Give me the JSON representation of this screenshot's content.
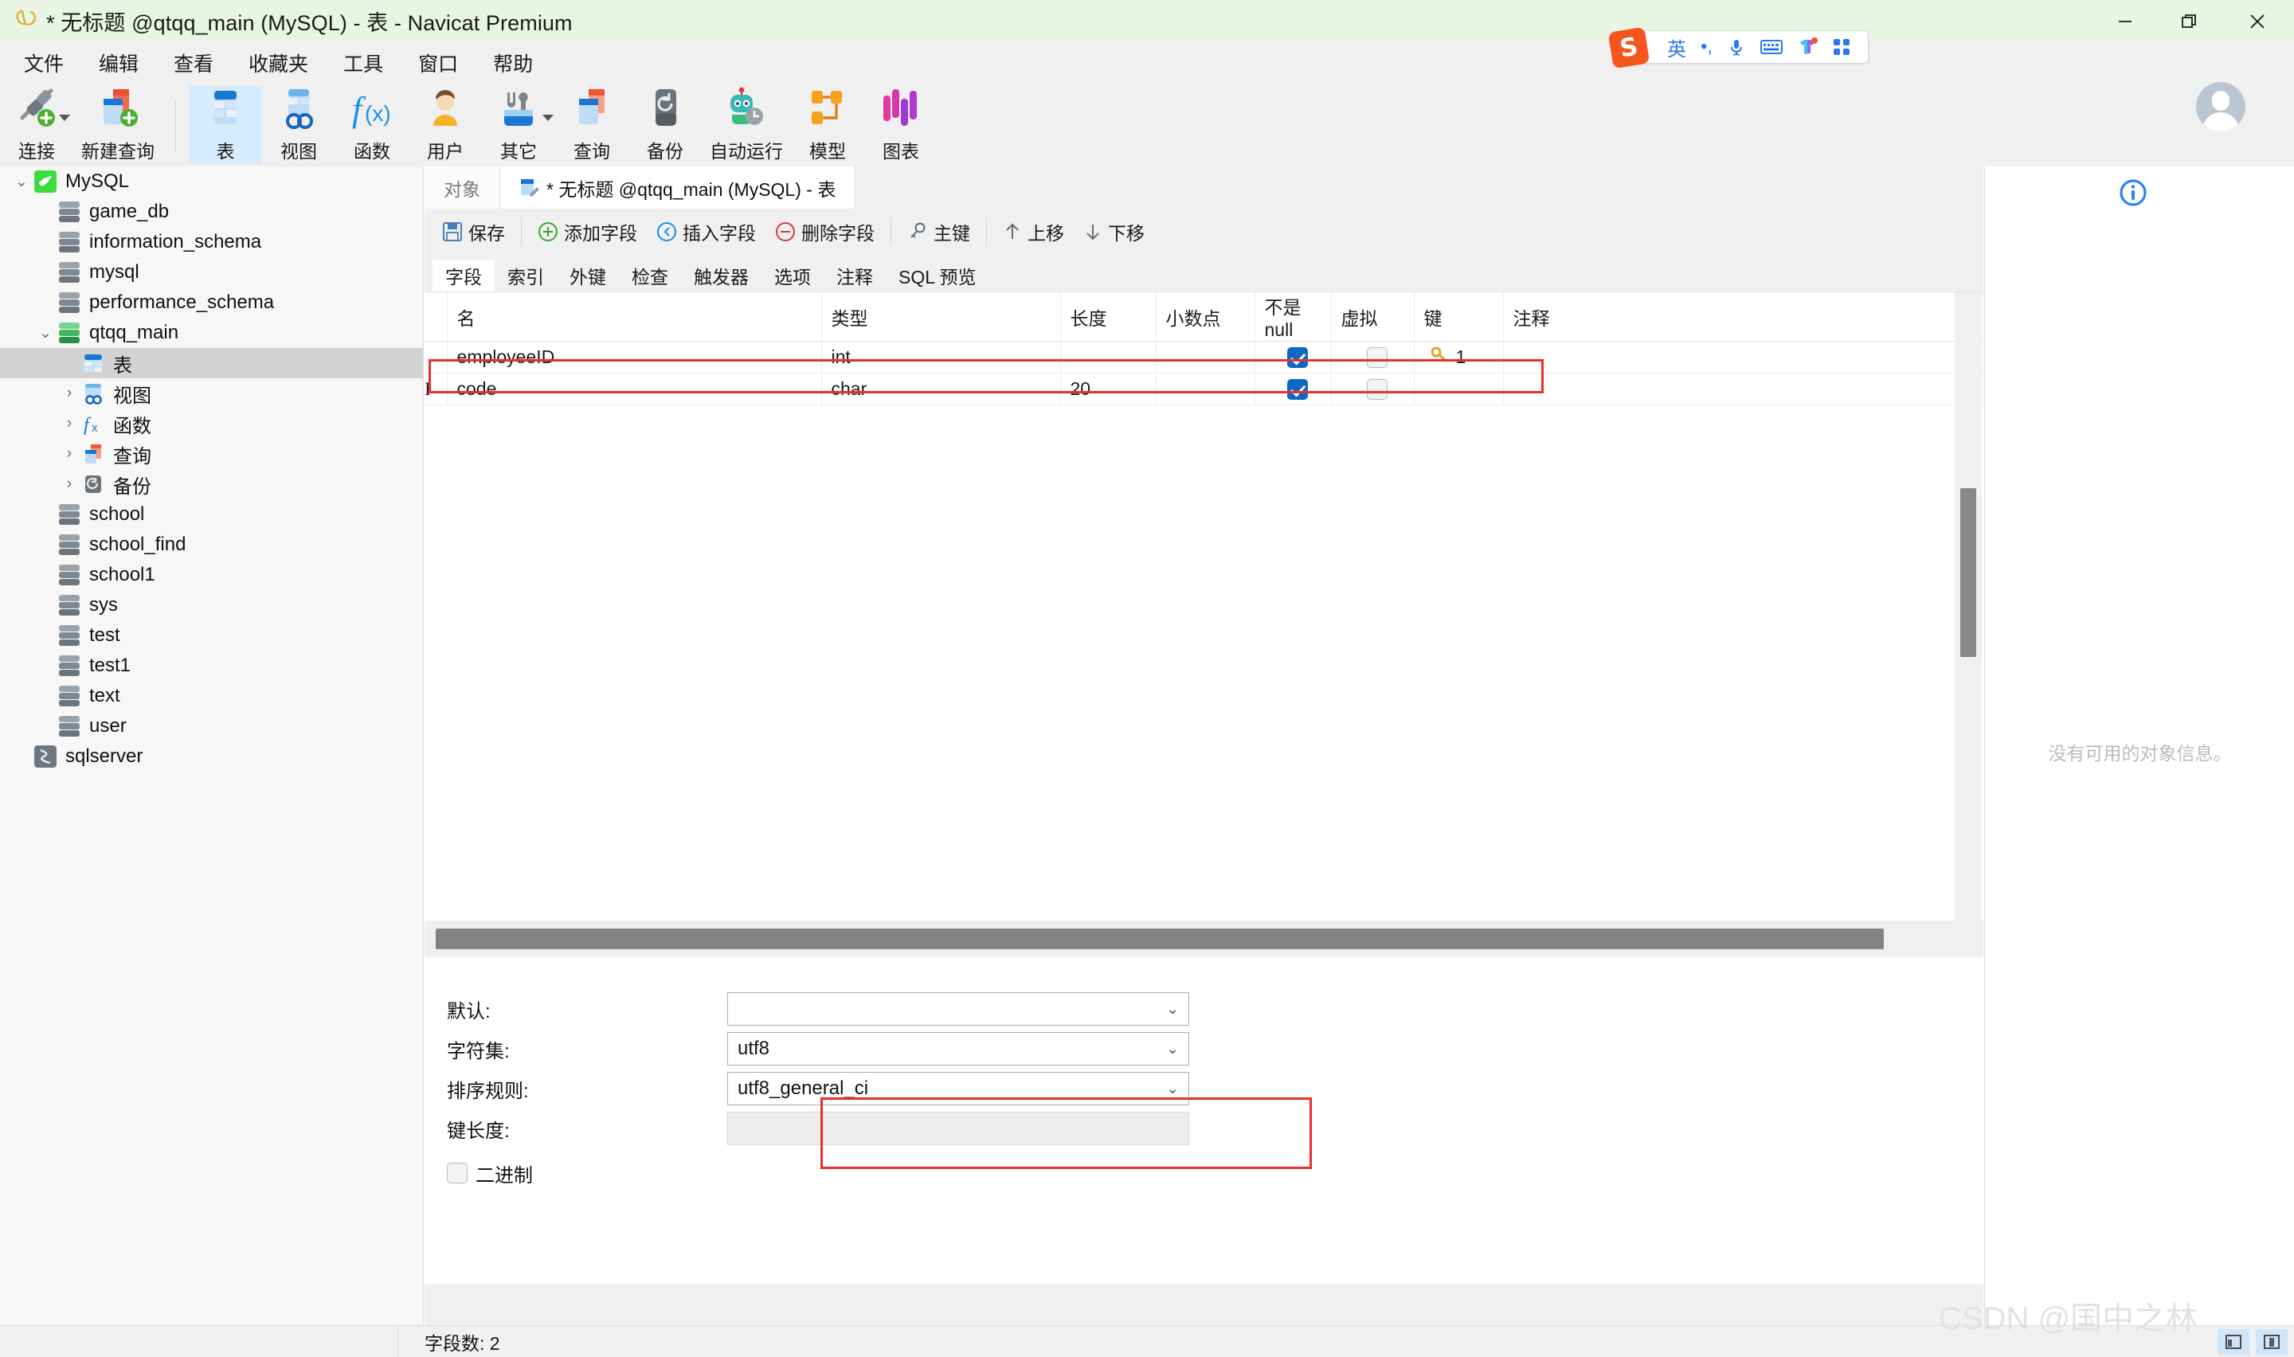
{
  "window": {
    "title": "* 无标题 @qtqq_main (MySQL) - 表 - Navicat Premium",
    "minimize_label": "—",
    "restore_label": "❐",
    "close_label": "✕",
    "titlebar_color": "#e8f5e3"
  },
  "menubar": {
    "items": [
      {
        "label": "文件"
      },
      {
        "label": "编辑"
      },
      {
        "label": "查看"
      },
      {
        "label": "收藏夹"
      },
      {
        "label": "工具"
      },
      {
        "label": "窗口"
      },
      {
        "label": "帮助"
      }
    ]
  },
  "ime": {
    "logo_text": "S",
    "mode_label": "英",
    "punct_label": "•,",
    "mic_label": "mic-icon",
    "keyboard_label": "keyboard-icon",
    "skin_label": "skin-icon",
    "apps_label": "apps-icon"
  },
  "toolbar": {
    "items": [
      {
        "label": "连接",
        "icon": "connection-icon",
        "dropdown": true,
        "active": false
      },
      {
        "label": "新建查询",
        "icon": "new-query-icon",
        "dropdown": false,
        "active": false
      },
      {
        "label": "表",
        "icon": "table-icon",
        "dropdown": false,
        "active": true
      },
      {
        "label": "视图",
        "icon": "view-icon",
        "dropdown": false,
        "active": false
      },
      {
        "label": "函数",
        "icon": "function-icon",
        "dropdown": false,
        "active": false
      },
      {
        "label": "用户",
        "icon": "user-icon",
        "dropdown": false,
        "active": false
      },
      {
        "label": "其它",
        "icon": "others-icon",
        "dropdown": true,
        "active": false
      },
      {
        "label": "查询",
        "icon": "query-icon",
        "dropdown": false,
        "active": false
      },
      {
        "label": "备份",
        "icon": "backup-icon",
        "dropdown": false,
        "active": false
      },
      {
        "label": "自动运行",
        "icon": "automation-icon",
        "dropdown": false,
        "active": false
      },
      {
        "label": "模型",
        "icon": "model-icon",
        "dropdown": false,
        "active": false
      },
      {
        "label": "图表",
        "icon": "chart-icon",
        "dropdown": false,
        "active": false
      }
    ]
  },
  "sidebar": {
    "items": [
      {
        "label": "MySQL",
        "indent": 0,
        "twisty": "down",
        "icon": "mysql-dolphin-icon",
        "selected": false
      },
      {
        "label": "game_db",
        "indent": 1,
        "twisty": "",
        "icon": "database-icon",
        "selected": false
      },
      {
        "label": "information_schema",
        "indent": 1,
        "twisty": "",
        "icon": "database-icon",
        "selected": false
      },
      {
        "label": "mysql",
        "indent": 1,
        "twisty": "",
        "icon": "database-icon",
        "selected": false
      },
      {
        "label": "performance_schema",
        "indent": 1,
        "twisty": "",
        "icon": "database-icon",
        "selected": false
      },
      {
        "label": "qtqq_main",
        "indent": 1,
        "twisty": "down",
        "icon": "database-open-icon",
        "selected": false
      },
      {
        "label": "表",
        "indent": 2,
        "twisty": "",
        "icon": "table-icon",
        "selected": true
      },
      {
        "label": "视图",
        "indent": 2,
        "twisty": "right",
        "icon": "view-icon",
        "selected": false
      },
      {
        "label": "函数",
        "indent": 2,
        "twisty": "right",
        "icon": "function-icon",
        "selected": false
      },
      {
        "label": "查询",
        "indent": 2,
        "twisty": "right",
        "icon": "query-icon",
        "selected": false
      },
      {
        "label": "备份",
        "indent": 2,
        "twisty": "right",
        "icon": "backup-icon",
        "selected": false
      },
      {
        "label": "school",
        "indent": 1,
        "twisty": "",
        "icon": "database-icon",
        "selected": false
      },
      {
        "label": "school_find",
        "indent": 1,
        "twisty": "",
        "icon": "database-icon",
        "selected": false
      },
      {
        "label": "school1",
        "indent": 1,
        "twisty": "",
        "icon": "database-icon",
        "selected": false
      },
      {
        "label": "sys",
        "indent": 1,
        "twisty": "",
        "icon": "database-icon",
        "selected": false
      },
      {
        "label": "test",
        "indent": 1,
        "twisty": "",
        "icon": "database-icon",
        "selected": false
      },
      {
        "label": "test1",
        "indent": 1,
        "twisty": "",
        "icon": "database-icon",
        "selected": false
      },
      {
        "label": "text",
        "indent": 1,
        "twisty": "",
        "icon": "database-icon",
        "selected": false
      },
      {
        "label": "user",
        "indent": 1,
        "twisty": "",
        "icon": "database-icon",
        "selected": false
      },
      {
        "label": "sqlserver",
        "indent": 0,
        "twisty": "",
        "icon": "sqlserver-icon",
        "selected": false
      }
    ]
  },
  "doctabs": [
    {
      "label": "对象",
      "active": false,
      "icon": ""
    },
    {
      "label": "* 无标题 @qtqq_main (MySQL) - 表",
      "active": true,
      "icon": "table-edit-icon"
    }
  ],
  "editor_toolbar": [
    {
      "label": "保存",
      "icon": "save-icon"
    },
    {
      "label": "添加字段",
      "icon": "plus-circle-icon"
    },
    {
      "label": "插入字段",
      "icon": "insert-circle-icon"
    },
    {
      "label": "删除字段",
      "icon": "minus-circle-icon"
    },
    {
      "label": "主键",
      "icon": "key-icon"
    },
    {
      "label": "上移",
      "icon": "arrow-up-icon"
    },
    {
      "label": "下移",
      "icon": "arrow-down-icon"
    }
  ],
  "subtabs": [
    {
      "label": "字段",
      "active": true
    },
    {
      "label": "索引",
      "active": false
    },
    {
      "label": "外键",
      "active": false
    },
    {
      "label": "检查",
      "active": false
    },
    {
      "label": "触发器",
      "active": false
    },
    {
      "label": "选项",
      "active": false
    },
    {
      "label": "注释",
      "active": false
    },
    {
      "label": "SQL 预览",
      "active": false
    }
  ],
  "grid": {
    "columns": [
      "名",
      "类型",
      "长度",
      "小数点",
      "不是 null",
      "虚拟",
      "键",
      "注释"
    ],
    "rows": [
      {
        "marker": "",
        "name": "employeeID",
        "type": "int",
        "length": "",
        "decimals": "",
        "not_null": true,
        "virtual": false,
        "key": "1",
        "key_icon": "primary-key-icon",
        "comment": "",
        "highlighted": false
      },
      {
        "marker": "I",
        "name": "code",
        "type": "char",
        "length": "20",
        "decimals": "",
        "not_null": true,
        "virtual": false,
        "key": "",
        "key_icon": "",
        "comment": "",
        "highlighted": true
      }
    ],
    "highlight_color": "#ec2d2d"
  },
  "properties": {
    "default": {
      "label": "默认:",
      "value": "",
      "placeholder": ""
    },
    "charset": {
      "label": "字符集:",
      "value": "utf8"
    },
    "collation": {
      "label": "排序规则:",
      "value": "utf8_general_ci"
    },
    "key_length": {
      "label": "键长度:",
      "value": ""
    },
    "binary": {
      "label": "二进制",
      "checked": false
    },
    "highlight_color": "#ec2d2d"
  },
  "right_panel": {
    "info_icon": "info-circle-icon",
    "empty_text": "没有可用的对象信息。"
  },
  "statusbar": {
    "field_count": "字段数: 2",
    "view_grid_icon": "grid-view-icon",
    "view_form_icon": "form-view-icon"
  },
  "watermark": "CSDN @国中之林"
}
